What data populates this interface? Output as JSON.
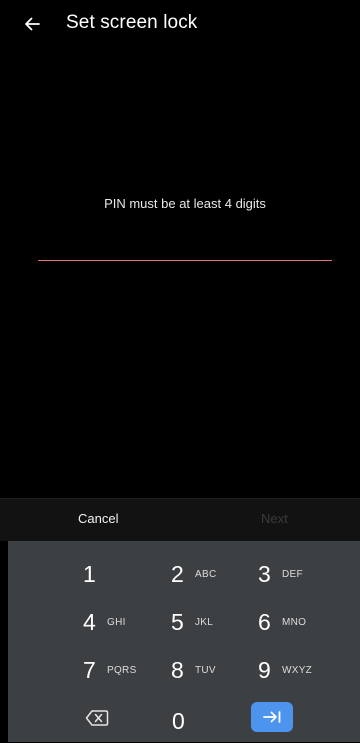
{
  "header": {
    "title": "Set screen lock",
    "back_icon": "arrow-back-icon"
  },
  "pin": {
    "message": "PIN must be at least 4 digits",
    "value": "",
    "underline_color": "#e57373"
  },
  "actions": {
    "cancel_label": "Cancel",
    "next_label": "Next",
    "next_enabled": false
  },
  "keypad": {
    "background": "#3c4043",
    "enter_color": "#4d94ee",
    "keys": [
      {
        "digit": "1",
        "letters": ""
      },
      {
        "digit": "2",
        "letters": "ABC"
      },
      {
        "digit": "3",
        "letters": "DEF"
      },
      {
        "digit": "4",
        "letters": "GHI"
      },
      {
        "digit": "5",
        "letters": "JKL"
      },
      {
        "digit": "6",
        "letters": "MNO"
      },
      {
        "digit": "7",
        "letters": "PQRS"
      },
      {
        "digit": "8",
        "letters": "TUV"
      },
      {
        "digit": "9",
        "letters": "WXYZ"
      }
    ],
    "zero": "0",
    "backspace_icon": "backspace-icon",
    "enter_icon": "tab-enter-icon"
  }
}
